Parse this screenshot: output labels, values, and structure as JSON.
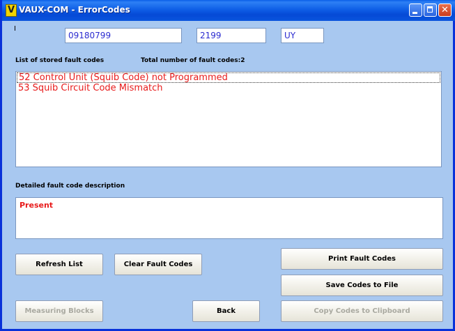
{
  "window": {
    "title": "VAUX-COM - ErrorCodes",
    "icon_letter": "V"
  },
  "header": {
    "indicator": "I",
    "field1": "09180799",
    "field2": "2199",
    "field3": "UY"
  },
  "list_section": {
    "label": "List of stored fault codes",
    "total_label": "Total number of fault codes:2",
    "items": [
      "52  Control Unit (Squib Code) not Programmed",
      "53  Squib Circuit Code Mismatch"
    ]
  },
  "description_section": {
    "label": "Detailed fault code description",
    "text": "Present"
  },
  "buttons": {
    "refresh": "Refresh List",
    "clear": "Clear Fault Codes",
    "print": "Print Fault Codes",
    "save": "Save Codes to File",
    "measuring": "Measuring Blocks",
    "back": "Back",
    "copy": "Copy Codes to Clipboard"
  },
  "colors": {
    "fault_text": "#e81b1b",
    "field_text": "#2b2bd0",
    "background": "#a8c8f0",
    "titlebar": "#0a55dd"
  }
}
